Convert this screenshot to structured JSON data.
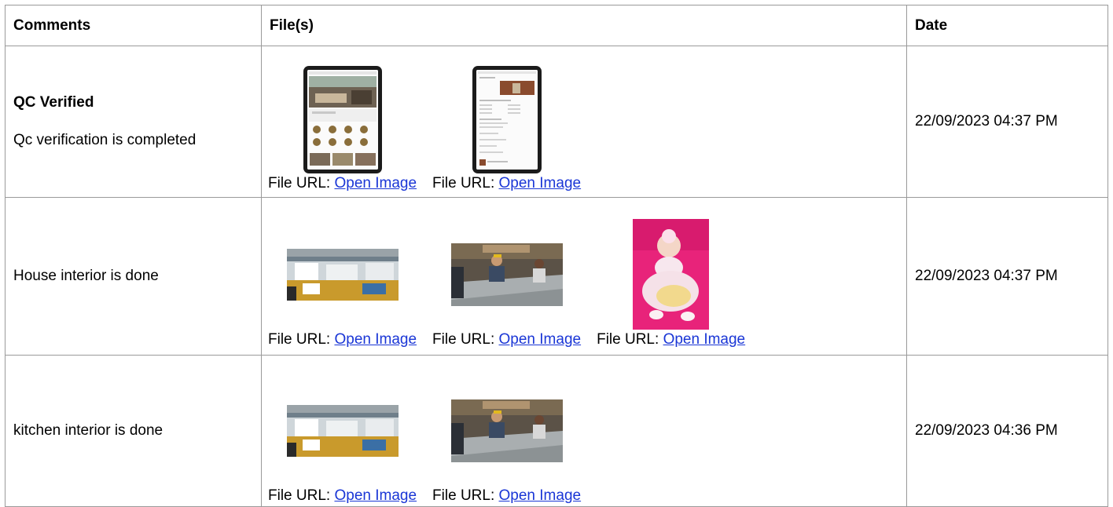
{
  "table": {
    "headers": [
      "Comments",
      "File(s)",
      "Date"
    ],
    "file_url_label": "File URL:",
    "link_text": "Open Image",
    "rows": [
      {
        "title": "QC Verified",
        "comment": "Qc verification is completed",
        "date": "22/09/2023 04:37 PM",
        "files": [
          "tablet-homepage-image",
          "tablet-product-page-image"
        ]
      },
      {
        "comment": "House interior is done",
        "date": "22/09/2023 04:37 PM",
        "files": [
          "factory-floor-image",
          "workers-image",
          "baby-photo-image"
        ]
      },
      {
        "comment": "kitchen interior is done",
        "date": "22/09/2023 04:36 PM",
        "files": [
          "factory-floor-image",
          "workers-image"
        ]
      }
    ]
  },
  "colors": {
    "link": "#1a36d6",
    "border": "#9a9a9a",
    "baby_background": "#e8237a"
  }
}
